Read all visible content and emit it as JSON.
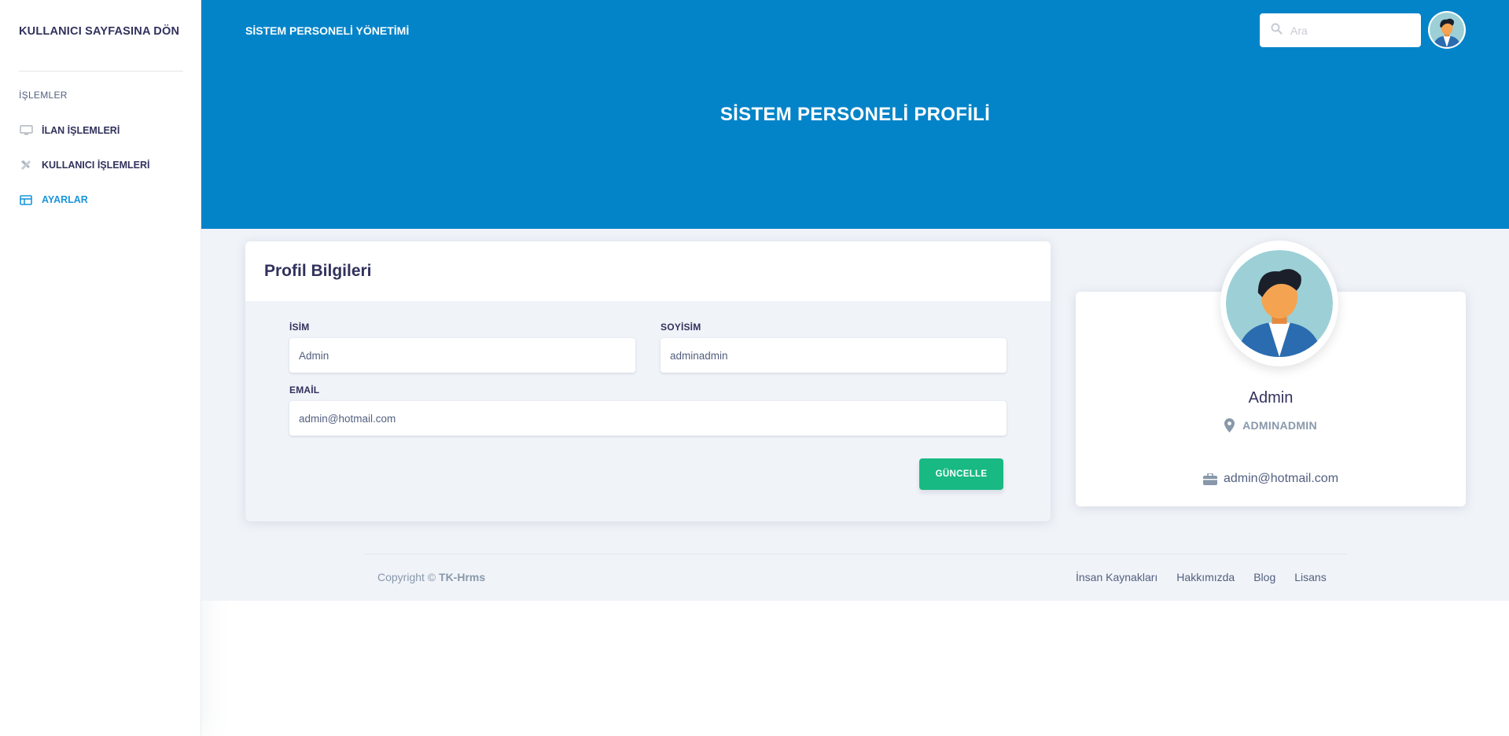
{
  "sidebar": {
    "brand": "KULLANICI SAYFASINA DÖN",
    "heading": "İŞLEMLER",
    "items": [
      {
        "label": "İLAN İŞLEMLERİ",
        "icon": "monitor-icon"
      },
      {
        "label": "KULLANICI İŞLEMLERİ",
        "icon": "tools-icon"
      },
      {
        "label": "AYARLAR",
        "icon": "table-icon",
        "active": true
      }
    ]
  },
  "header": {
    "title": "SİSTEM PERSONELİ YÖNETİMİ",
    "search_placeholder": "Ara",
    "page_heading": "SİSTEM PERSONELİ PROFİLİ"
  },
  "form": {
    "title": "Profil Bilgileri",
    "name_label": "İSİM",
    "name_value": "Admin",
    "surname_label": "SOYİSİM",
    "surname_value": "adminadmin",
    "email_label": "EMAİL",
    "email_value": "admin@hotmail.com",
    "submit_label": "GÜNCELLE"
  },
  "profile_card": {
    "name": "Admin",
    "location": "ADMINADMIN",
    "email": "admin@hotmail.com"
  },
  "footer": {
    "copyright_prefix": "Copyright ©",
    "copyright_brand": "TK-Hrms",
    "links": [
      "İnsan Kaynakları",
      "Hakkımızda",
      "Blog",
      "Lisans"
    ]
  },
  "colors": {
    "primary": "#0384c9",
    "success": "#18b982",
    "sidebar_active": "#1a96db",
    "content_bg": "#f0f3f8"
  }
}
